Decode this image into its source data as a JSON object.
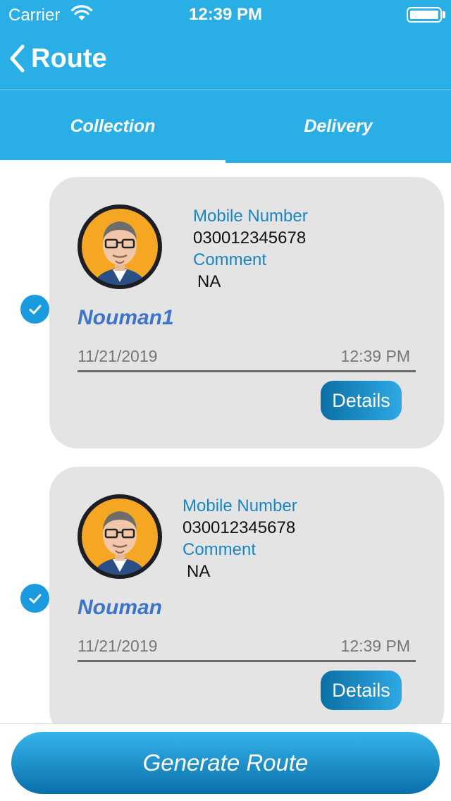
{
  "status_bar": {
    "carrier": "Carrier",
    "time": "12:39 PM"
  },
  "nav": {
    "title": "Route"
  },
  "tabs": [
    {
      "label": "Collection",
      "selected": true
    },
    {
      "label": "Delivery",
      "selected": false
    }
  ],
  "cards": [
    {
      "checked": true,
      "mobile_label": "Mobile Number",
      "mobile": "030012345678",
      "comment_label": "Comment",
      "comment": "NA",
      "name": "Nouman1",
      "date": "11/21/2019",
      "time": "12:39 PM",
      "details_label": "Details"
    },
    {
      "checked": true,
      "mobile_label": "Mobile Number",
      "mobile": "030012345678",
      "comment_label": "Comment",
      "comment": "NA",
      "name": "Nouman",
      "date": "11/21/2019",
      "time": "12:39 PM",
      "details_label": "Details"
    }
  ],
  "footer": {
    "button_label": "Generate Route"
  },
  "colors": {
    "primary": "#2aaee6",
    "name_text": "#3d74c9",
    "label_text": "#1b85c4",
    "card_bg": "#e4e4e4"
  },
  "icons": {
    "back": "chevron-left-icon",
    "check": "checkmark-circle-icon",
    "wifi": "wifi-icon",
    "battery": "battery-icon"
  }
}
